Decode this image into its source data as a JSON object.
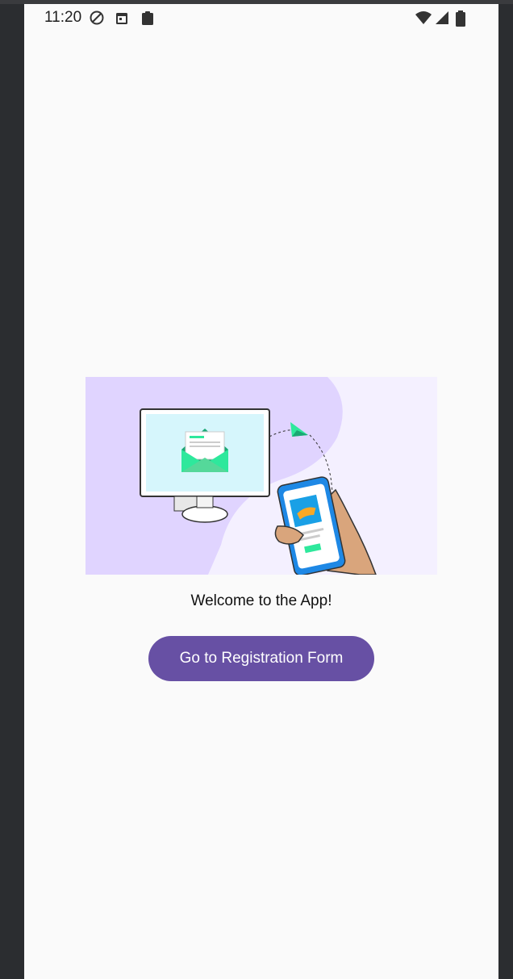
{
  "status_bar": {
    "time": "11:20",
    "icons": [
      "do-not-disturb-icon",
      "calendar-icon",
      "clipboard-icon",
      "wifi-icon",
      "cellular-signal-icon",
      "battery-icon"
    ]
  },
  "main": {
    "illustration_icon": "email-to-phone-illustration",
    "welcome_text": "Welcome to the App!",
    "cta_label": "Go to Registration Form"
  },
  "colors": {
    "primary": "#6750a4",
    "background": "#fafafa",
    "illustration_lavender": "#e0d4ff",
    "illustration_green": "#2ee89c"
  }
}
